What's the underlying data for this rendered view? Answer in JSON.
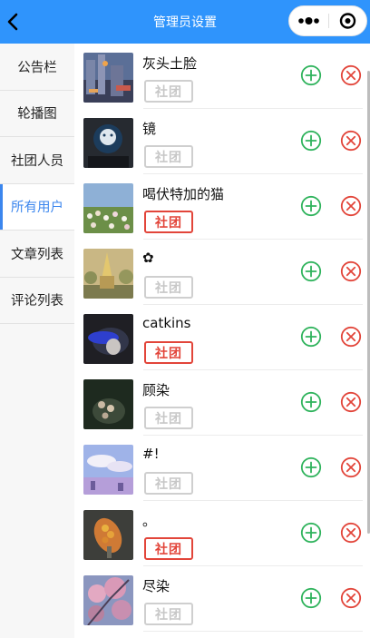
{
  "navbar": {
    "title": "管理员设置",
    "bg_color": "#2f94fc",
    "back_icon": "chevron-left-icon",
    "capsule_icons": [
      "more-dots-icon",
      "close-circle-icon"
    ]
  },
  "sidebar": {
    "active_index": 3,
    "active_color": "#3b86ee",
    "items": [
      {
        "label": "公告栏"
      },
      {
        "label": "轮播图"
      },
      {
        "label": "社团人员"
      },
      {
        "label": "所有用户"
      },
      {
        "label": "文章列表"
      },
      {
        "label": "评论列表"
      }
    ]
  },
  "users": [
    {
      "name": "灰头土脸",
      "badge": "社团",
      "club_member": false
    },
    {
      "name": "镜",
      "badge": "社团",
      "club_member": false
    },
    {
      "name": "喝伏特加的猫",
      "badge": "社团",
      "club_member": true
    },
    {
      "name": "✿",
      "badge": "社团",
      "club_member": false
    },
    {
      "name": "catkins",
      "badge": "社团",
      "club_member": true
    },
    {
      "name": "顾染",
      "badge": "社团",
      "club_member": false
    },
    {
      "name": "#!",
      "badge": "社团",
      "club_member": false
    },
    {
      "name": "。",
      "badge": "社团",
      "club_member": true
    },
    {
      "name": "尽染",
      "badge": "社团",
      "club_member": false
    }
  ],
  "actions": {
    "add_icon": "plus-circle-icon",
    "add_color": "#2fb35c",
    "remove_icon": "x-circle-icon",
    "remove_color": "#e2453a"
  }
}
